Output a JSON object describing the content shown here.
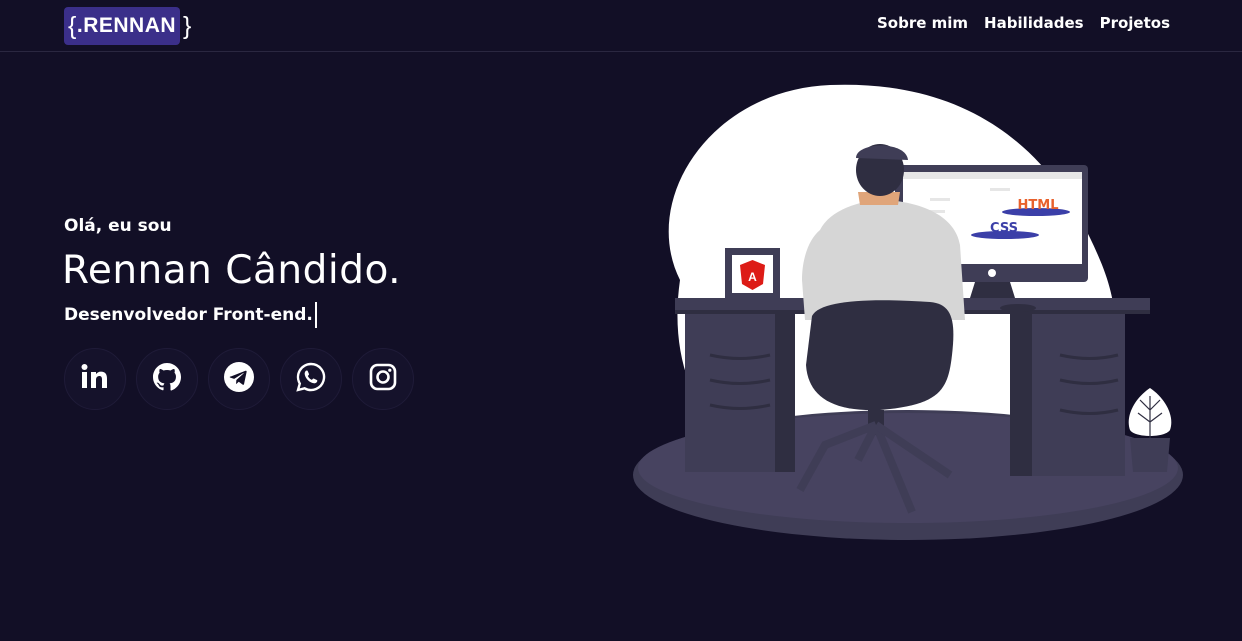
{
  "brand": {
    "open": "{",
    "text": ".RENNAN",
    "close": "}"
  },
  "nav": [
    {
      "label": "Sobre mim"
    },
    {
      "label": "Habilidades"
    },
    {
      "label": "Projetos"
    }
  ],
  "hero": {
    "greeting": "Olá, eu sou",
    "name": "Rennan Cândido.",
    "role": "Desenvolvedor Front-end."
  },
  "socials": [
    {
      "icon": "linkedin-icon"
    },
    {
      "icon": "github-icon"
    },
    {
      "icon": "telegram-icon"
    },
    {
      "icon": "whatsapp-icon"
    },
    {
      "icon": "instagram-icon"
    }
  ],
  "illustration": {
    "screen_labels": {
      "html": "HTML",
      "css": "CSS"
    },
    "frame_letter": "A"
  },
  "colors": {
    "background": "#120f26",
    "brand_box": "#3b2f8a",
    "text": "#ffffff",
    "desk": "#3f3d56",
    "html_label": "#e8612c",
    "css_label": "#3b3fa8",
    "angular": "#dd1b16"
  }
}
